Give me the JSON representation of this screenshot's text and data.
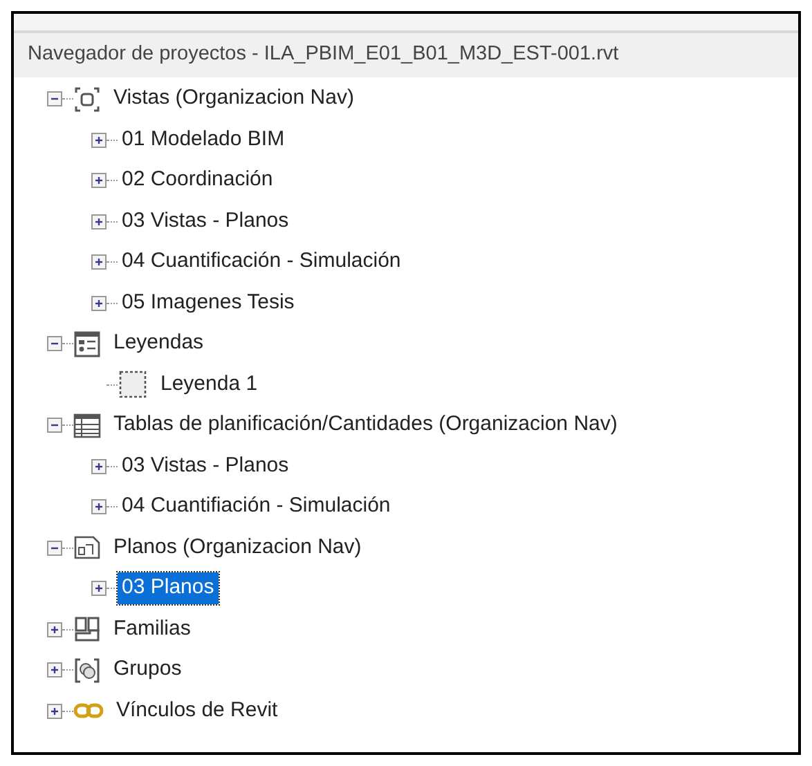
{
  "panel": {
    "title": "Navegador de proyectos - ILA_PBIM_E01_B01_M3D_EST-001.rvt"
  },
  "tree": [
    {
      "label": "Vistas (Organizacion Nav)",
      "kind": "views",
      "expanded": true,
      "selected": false,
      "children": [
        {
          "label": "01 Modelado BIM",
          "expanded": false,
          "selected": false
        },
        {
          "label": "02 Coordinación",
          "expanded": false,
          "selected": false
        },
        {
          "label": "03 Vistas - Planos",
          "expanded": false,
          "selected": false
        },
        {
          "label": "04 Cuantificación - Simulación",
          "expanded": false,
          "selected": false
        },
        {
          "label": "05 Imagenes Tesis",
          "expanded": false,
          "selected": false
        }
      ]
    },
    {
      "label": "Leyendas",
      "kind": "legends",
      "expanded": true,
      "selected": false,
      "children": [
        {
          "label": "Leyenda 1",
          "kind": "legend",
          "selected": false
        }
      ]
    },
    {
      "label": "Tablas de planificación/Cantidades (Organizacion Nav)",
      "kind": "schedules",
      "expanded": true,
      "selected": false,
      "children": [
        {
          "label": "03 Vistas - Planos",
          "expanded": false,
          "selected": false
        },
        {
          "label": "04 Cuantifiación - Simulación",
          "expanded": false,
          "selected": false
        }
      ]
    },
    {
      "label": "Planos (Organizacion Nav)",
      "kind": "sheets",
      "expanded": true,
      "selected": false,
      "children": [
        {
          "label": "03 Planos",
          "expanded": false,
          "selected": true
        }
      ]
    },
    {
      "label": "Familias",
      "kind": "families",
      "expanded": false,
      "selected": false
    },
    {
      "label": "Grupos",
      "kind": "groups",
      "expanded": false,
      "selected": false
    },
    {
      "label": "Vínculos de Revit",
      "kind": "links",
      "expanded": false,
      "selected": false
    }
  ]
}
